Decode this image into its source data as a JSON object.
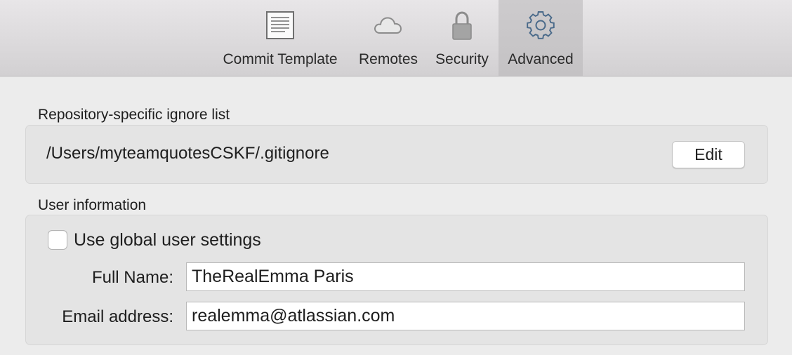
{
  "toolbar": {
    "tabs": [
      {
        "label": "Commit Template",
        "icon": "document-icon",
        "selected": false
      },
      {
        "label": "Remotes",
        "icon": "cloud-icon",
        "selected": false
      },
      {
        "label": "Security",
        "icon": "lock-icon",
        "selected": false
      },
      {
        "label": "Advanced",
        "icon": "gear-icon",
        "selected": true
      }
    ]
  },
  "ignore_list": {
    "title": "Repository-specific ignore list",
    "path": "/Users/myteamquotesCSKF/.gitignore",
    "edit_label": "Edit"
  },
  "user_info": {
    "title": "User information",
    "use_global_label": "Use global user settings",
    "use_global_checked": false,
    "full_name_label": "Full Name:",
    "full_name_value": "TheRealEmma Paris",
    "email_label": "Email address:",
    "email_value": "realemma@atlassian.com"
  },
  "colors": {
    "toolbar_bg": "#dcdadc",
    "selected_tab_bg": "#c6c4c6",
    "window_bg": "#ececec",
    "icon_gray": "#8c8c8c",
    "gear_blue": "#4a6a8a"
  }
}
